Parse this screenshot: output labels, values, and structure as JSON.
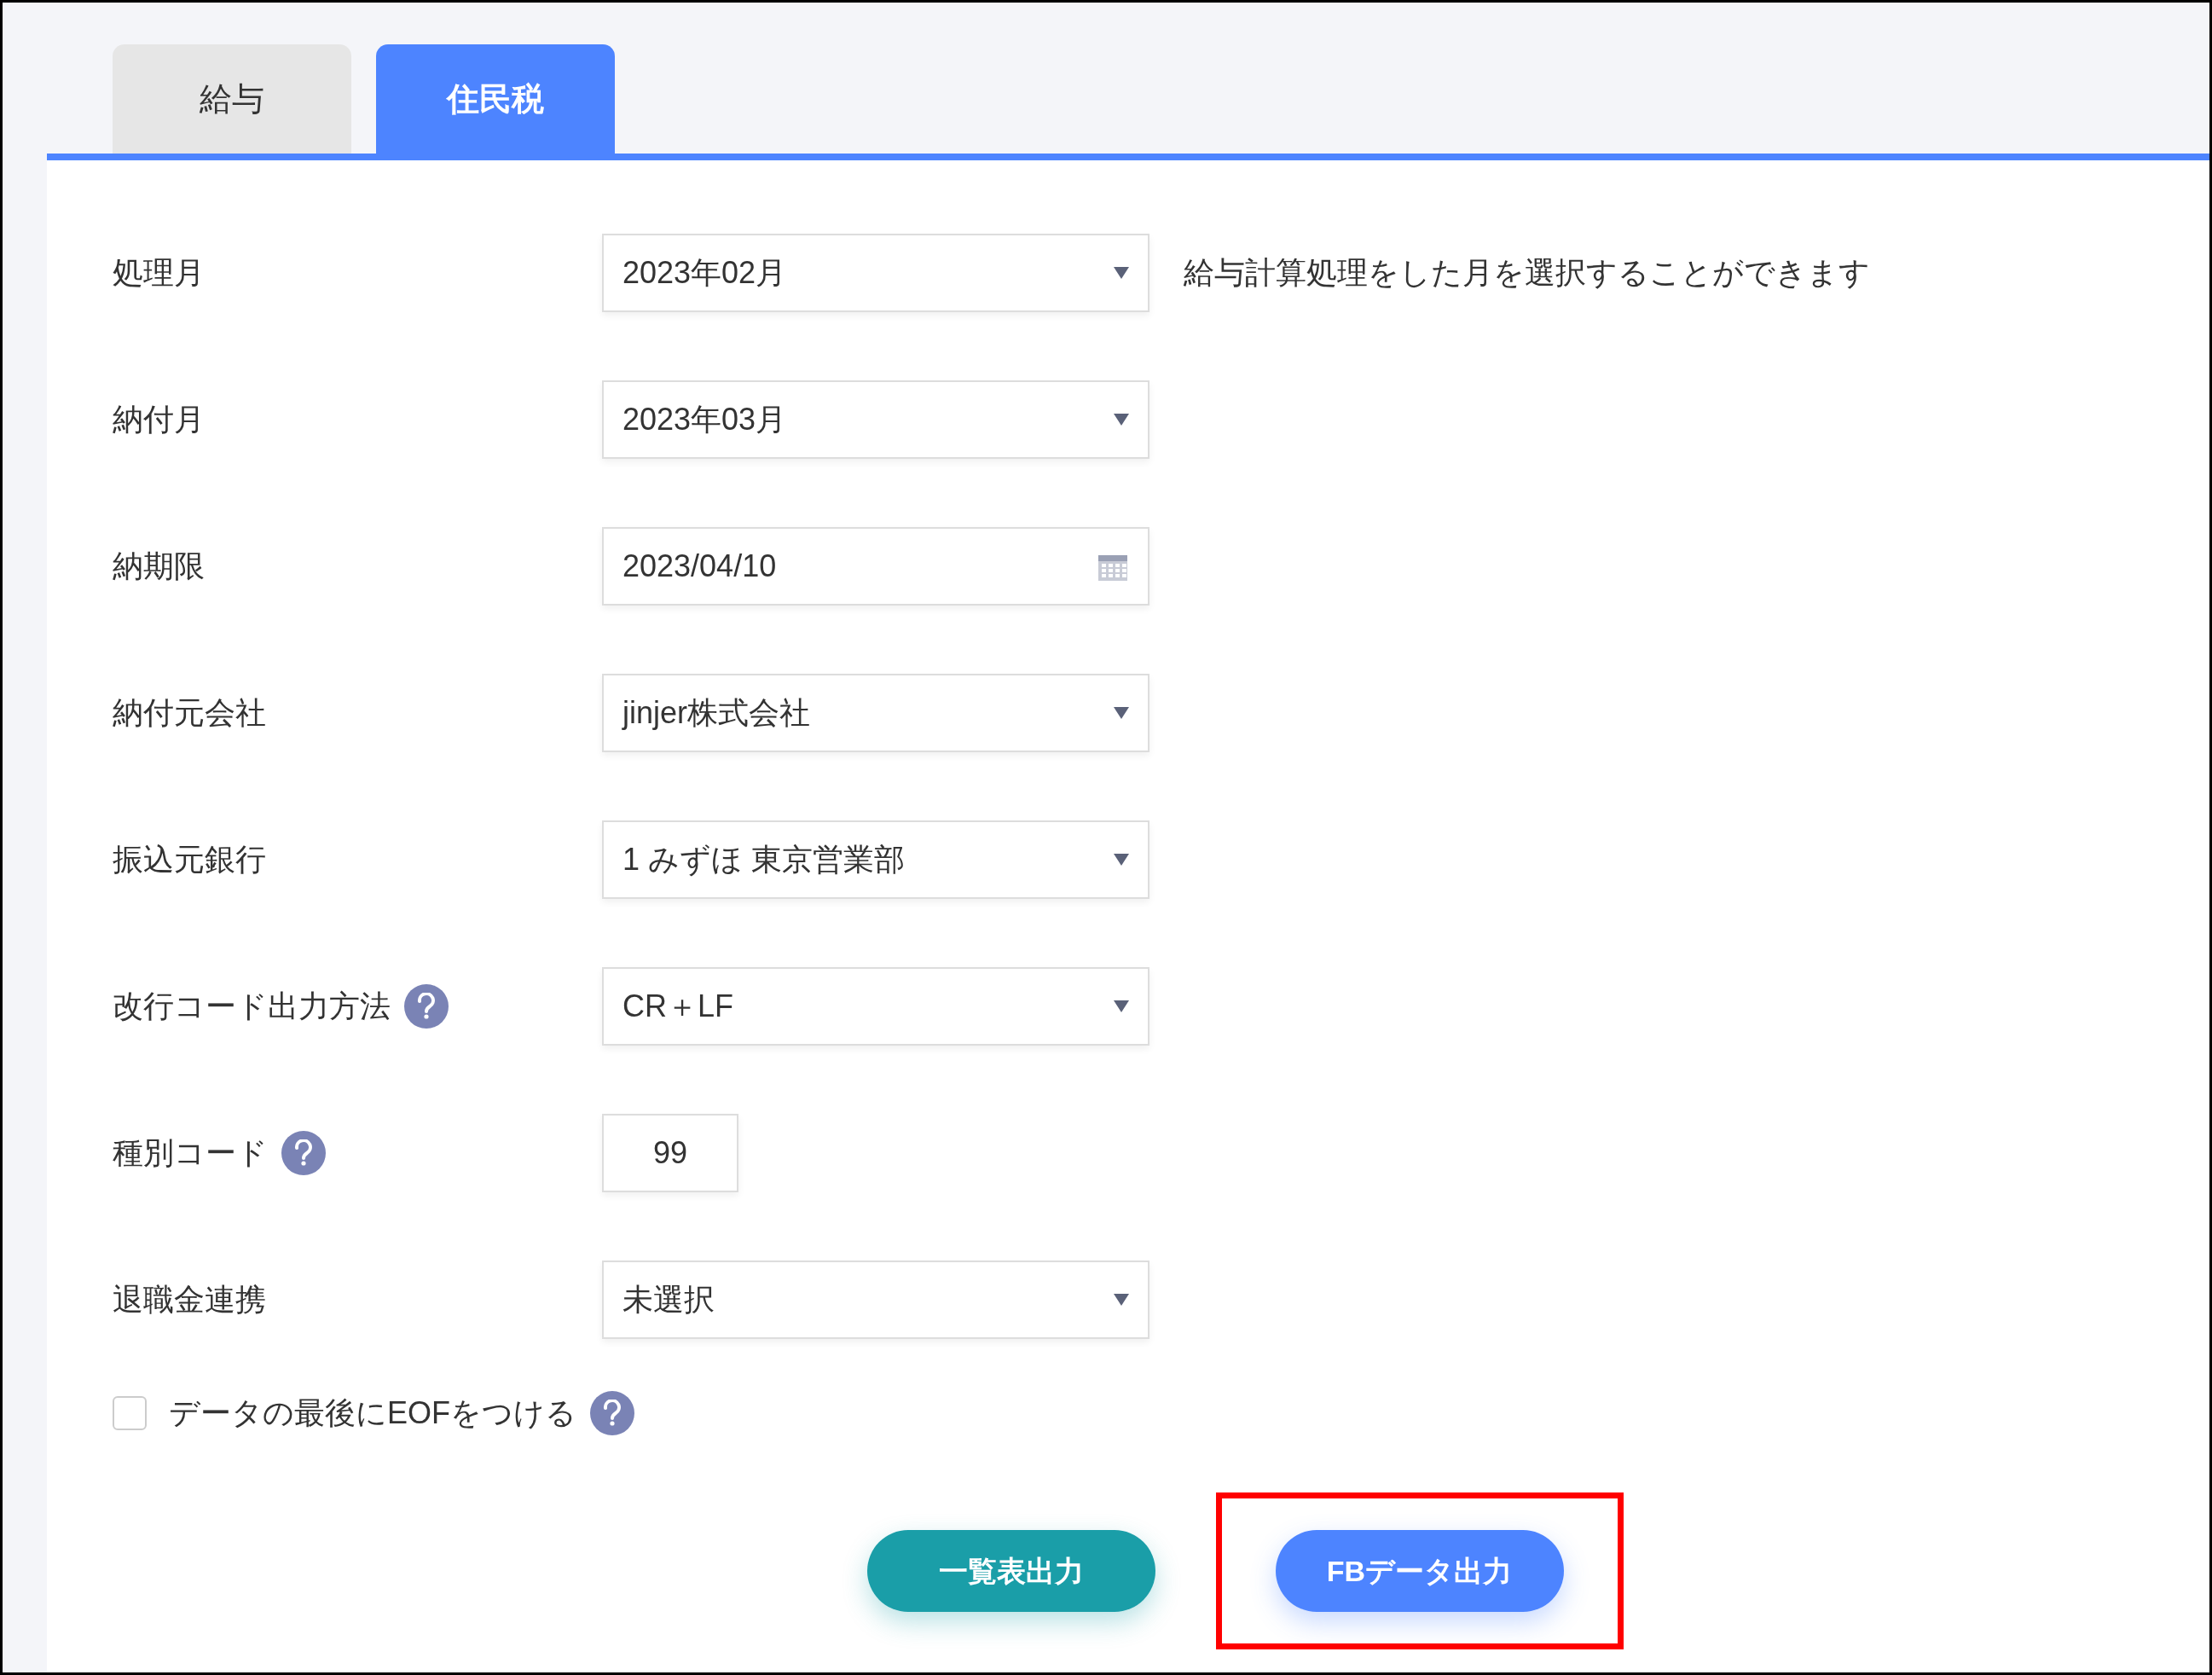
{
  "tabs": [
    {
      "label": "給与",
      "selected": false
    },
    {
      "label": "住民税",
      "selected": true
    }
  ],
  "form": {
    "rows": [
      {
        "label": "処理月",
        "help": false,
        "kind": "select",
        "value": "2023年02月",
        "hint": "給与計算処理をした月を選択することができます"
      },
      {
        "label": "納付月",
        "help": false,
        "kind": "select",
        "value": "2023年03月"
      },
      {
        "label": "納期限",
        "help": false,
        "kind": "date",
        "value": "2023/04/10"
      },
      {
        "label": "納付元会社",
        "help": false,
        "kind": "select",
        "value": "jinjer株式会社"
      },
      {
        "label": "振込元銀行",
        "help": false,
        "kind": "select",
        "value": "1 みずほ 東京営業部"
      },
      {
        "label": "改行コード出力方法",
        "help": true,
        "kind": "select",
        "value": "CR＋LF"
      },
      {
        "label": "種別コード",
        "help": true,
        "kind": "number",
        "value": "99"
      },
      {
        "label": "退職金連携",
        "help": false,
        "kind": "select",
        "value": "未選択"
      }
    ],
    "eof_checkbox": {
      "label": "データの最後にEOFをつける",
      "checked": false,
      "help": true
    }
  },
  "buttons": [
    {
      "label": "一覧表出力",
      "kind": "teal",
      "highlighted": false
    },
    {
      "label": "FBデータ出力",
      "kind": "blue",
      "highlighted": true
    }
  ]
}
